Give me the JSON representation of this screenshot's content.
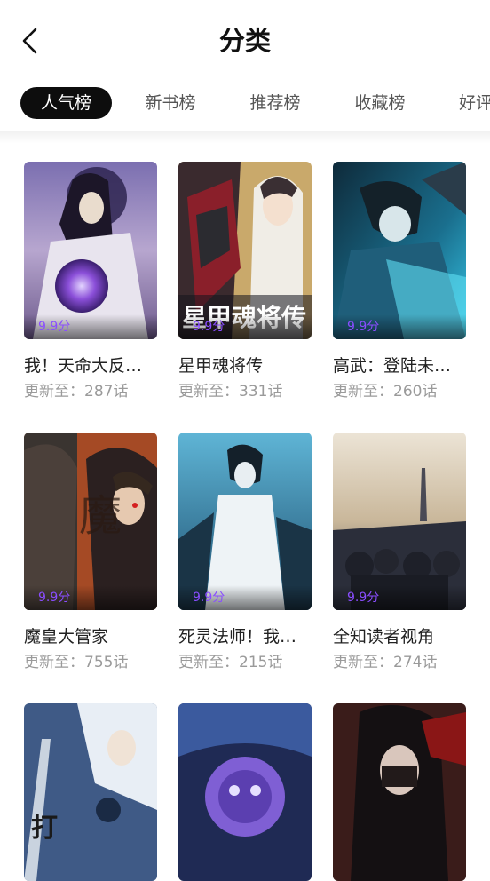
{
  "header": {
    "title": "分类",
    "back_icon": "chevron-left-icon"
  },
  "tabs": [
    {
      "label": "人气榜",
      "active": true
    },
    {
      "label": "新书榜",
      "active": false
    },
    {
      "label": "推荐榜",
      "active": false
    },
    {
      "label": "收藏榜",
      "active": false
    },
    {
      "label": "好评",
      "active": false
    }
  ],
  "colors": {
    "accent": "#0d0d0d",
    "score": "#8a4dff",
    "subtext": "#9a9a9a"
  },
  "comics": [
    {
      "title": "我！天命大反…",
      "score": "9.9分",
      "update": "更新至：287话"
    },
    {
      "title": "星甲魂将传",
      "score": "9.9分",
      "update": "更新至：331话"
    },
    {
      "title": "高武：登陆未…",
      "score": "9.9分",
      "update": "更新至：260话"
    },
    {
      "title": "魔皇大管家",
      "score": "9.9分",
      "update": "更新至：755话"
    },
    {
      "title": "死灵法师！我…",
      "score": "9.9分",
      "update": "更新至：215话"
    },
    {
      "title": "全知读者视角",
      "score": "9.9分",
      "update": "更新至：274话"
    },
    {
      "title": "",
      "score": "",
      "update": ""
    },
    {
      "title": "",
      "score": "",
      "update": ""
    },
    {
      "title": "",
      "score": "",
      "update": ""
    }
  ]
}
